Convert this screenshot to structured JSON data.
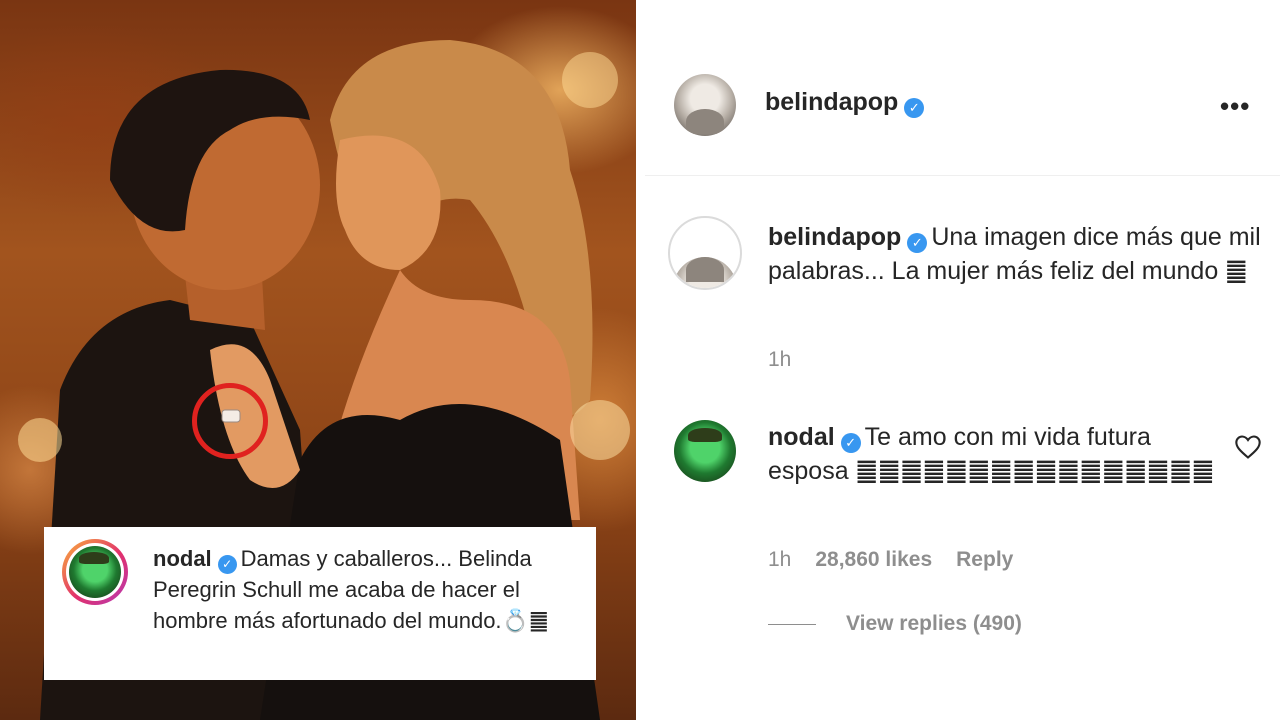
{
  "overlay_comment": {
    "username": "nodal",
    "text": "Damas y caballeros... Belinda Peregrin Schull me acaba de hacer el hombre más afortunado del mundo.💍䷀"
  },
  "post": {
    "header": {
      "username": "belindapop",
      "more_icon": "more-horizontal-icon"
    },
    "caption": {
      "username": "belindapop",
      "text": "Una imagen dice más que mil palabras... La mujer más feliz del mundo ䷀",
      "time": "1h"
    },
    "comment": {
      "username": "nodal",
      "text": "Te amo con mi vida futura esposa ䷀䷀䷀䷀䷀䷀䷀䷀䷀䷀䷀䷀䷀䷀䷀䷀",
      "time": "1h",
      "likes": "28,860 likes",
      "reply_label": "Reply",
      "view_replies": "View replies (490)"
    }
  },
  "colors": {
    "verified": "#3897f0",
    "highlight_circle": "#e0221f",
    "muted_text": "#8e8e8e"
  }
}
